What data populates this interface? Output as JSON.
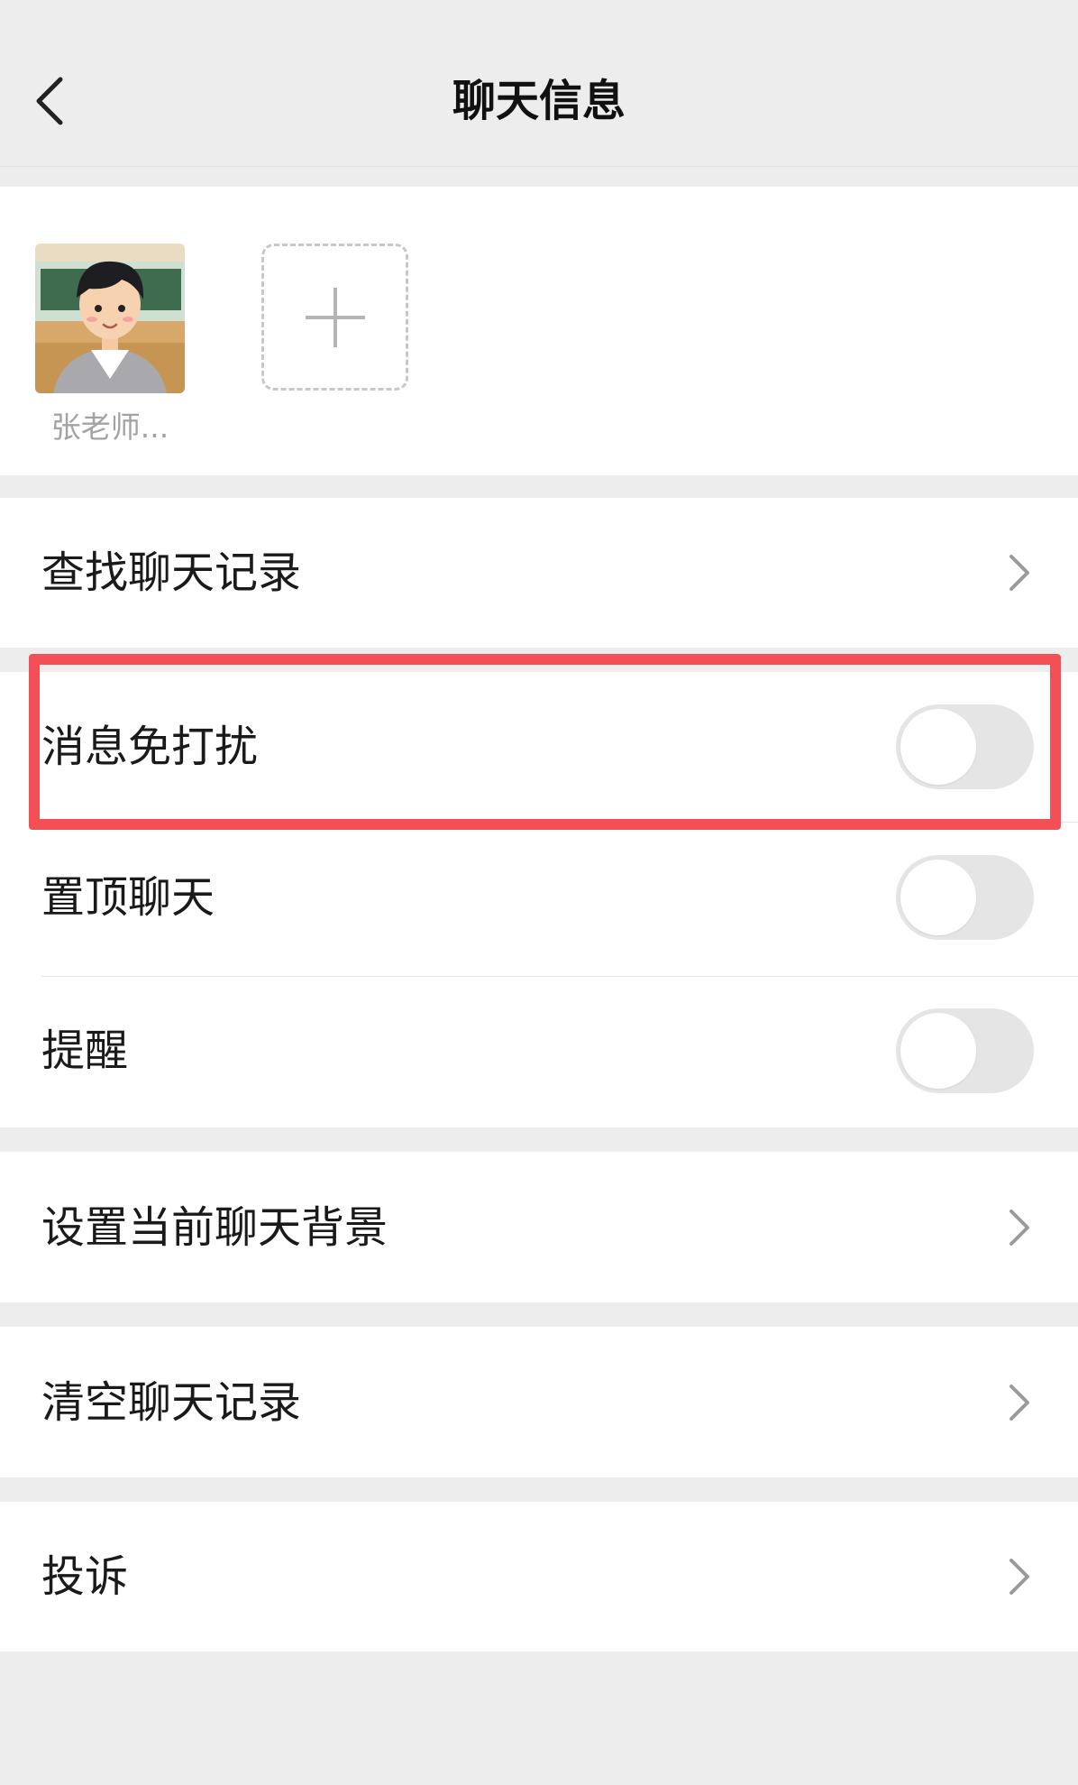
{
  "header": {
    "title": "聊天信息",
    "back_icon": "chevron-left-icon"
  },
  "members": [
    {
      "name": "张老师...",
      "avatar": "avatar-cartoon-teacher"
    }
  ],
  "add_member_icon": "plus-icon",
  "sections": {
    "search_history": {
      "label": "查找聊天记录",
      "icon": "chevron-right-icon"
    },
    "mute_notifications": {
      "label": "消息免打扰",
      "enabled": false
    },
    "pin_chat": {
      "label": "置顶聊天",
      "enabled": false
    },
    "remind": {
      "label": "提醒",
      "enabled": false
    },
    "set_background": {
      "label": "设置当前聊天背景",
      "icon": "chevron-right-icon"
    },
    "clear_history": {
      "label": "清空聊天记录",
      "icon": "chevron-right-icon"
    },
    "report": {
      "label": "投诉",
      "icon": "chevron-right-icon"
    }
  },
  "colors": {
    "page_bg": "#ededed",
    "card_bg": "#ffffff",
    "highlight": "#f24f57",
    "toggle_off": "#e5e5e5"
  }
}
